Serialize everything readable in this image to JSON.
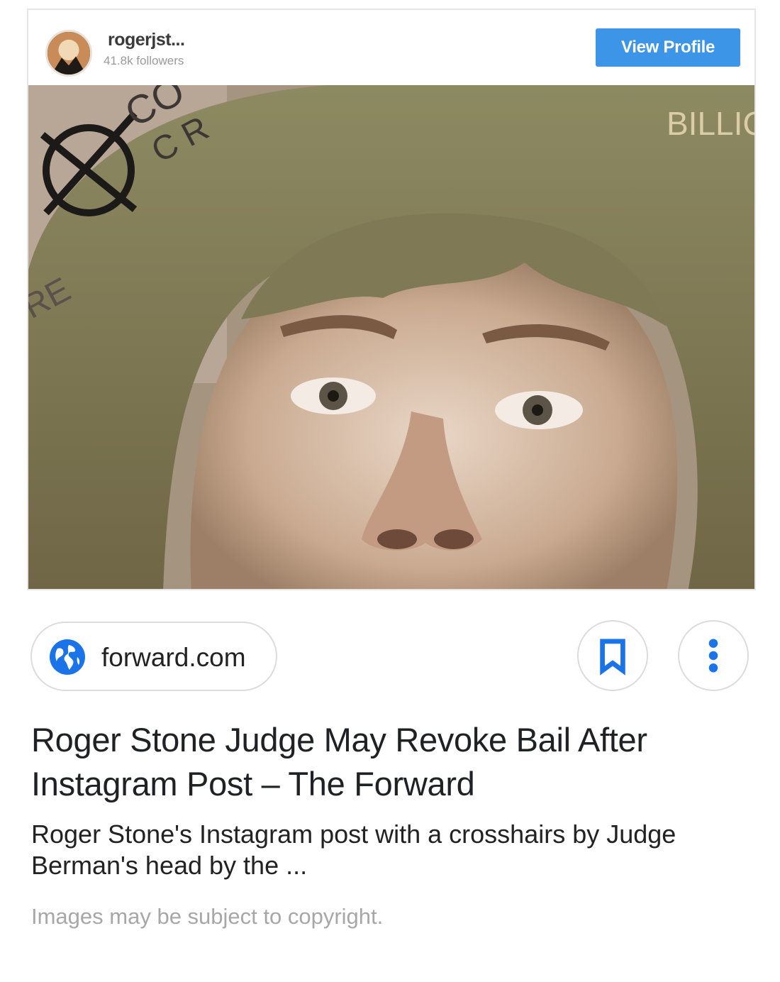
{
  "embed": {
    "username": "rogerjst...",
    "followers": "41.8k followers",
    "view_profile": "View Profile",
    "photo_overlay_text": [
      "CO",
      "C R",
      "RE",
      "BILLIC"
    ]
  },
  "result": {
    "source": "forward.com",
    "title": "Roger Stone Judge May Revoke Bail After Instagram Post – The Forward",
    "snippet": "Roger Stone's Instagram post with a crosshairs by Judge Berman's head by the ...",
    "copyright_note": "Images may be subject to copyright."
  },
  "icons": {
    "source": "globe-icon",
    "save": "bookmark-icon",
    "menu": "more-vertical-icon"
  },
  "colors": {
    "accent_blue": "#3d95e8",
    "icon_blue": "#1a73e8",
    "muted_text": "#a7a7a7"
  }
}
